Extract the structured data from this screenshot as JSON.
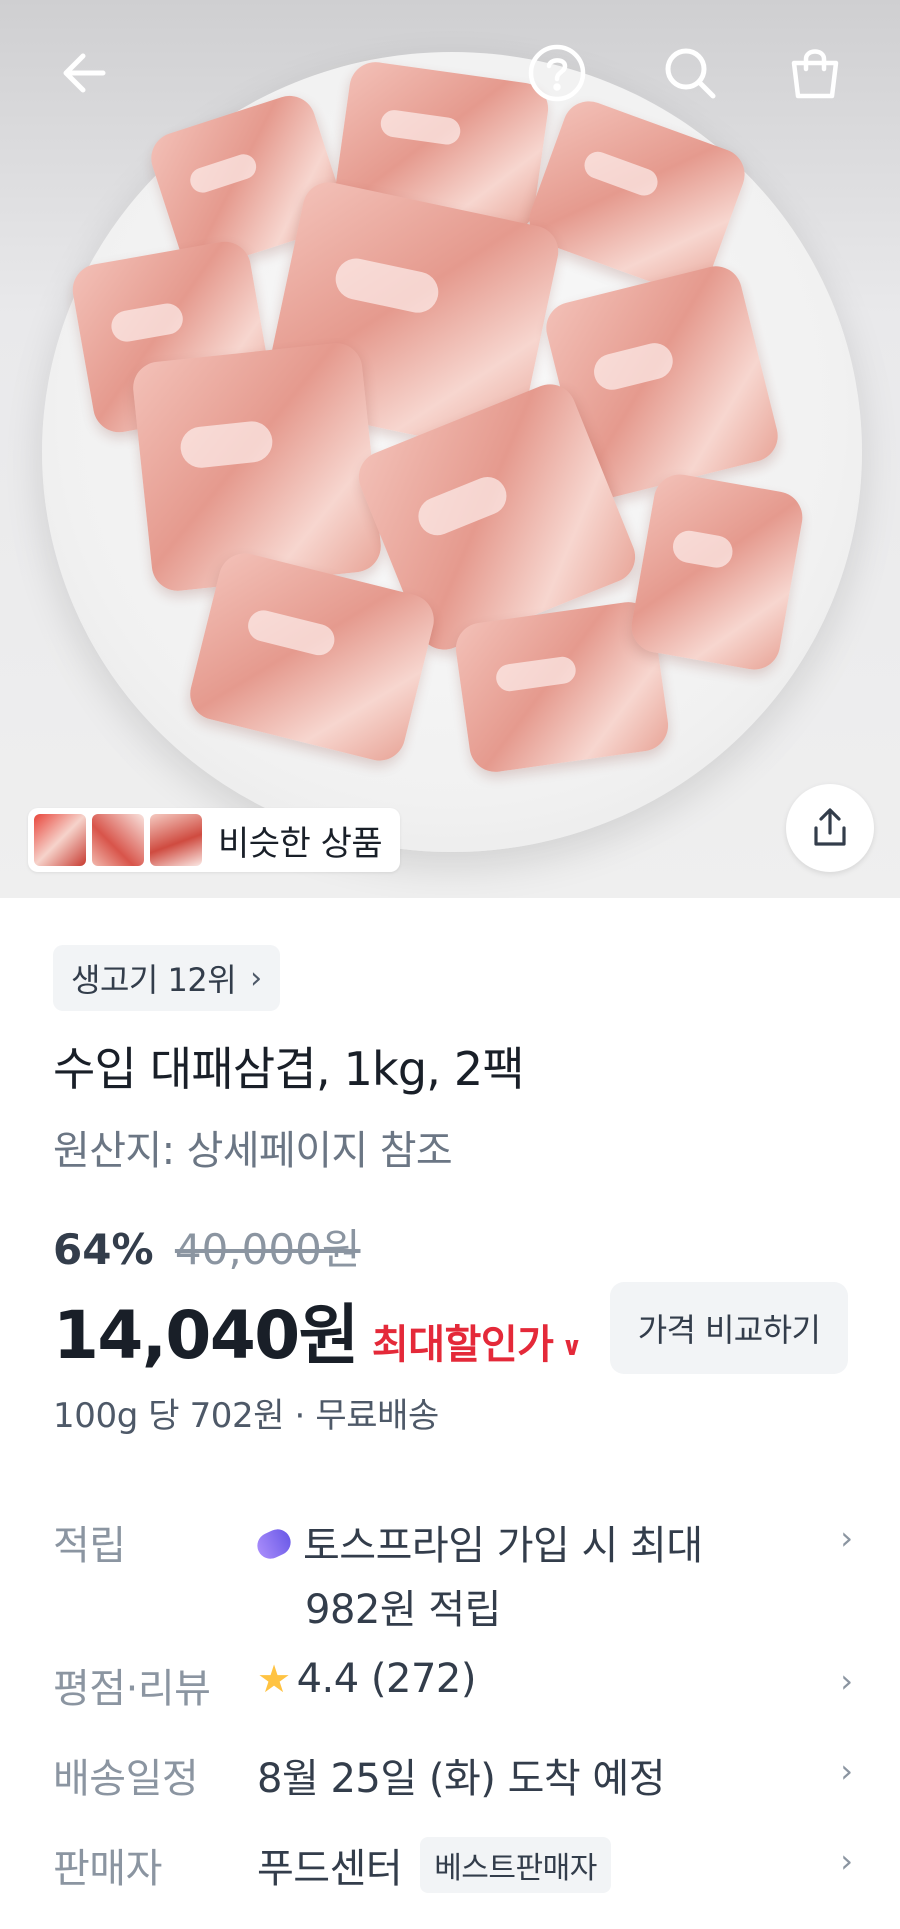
{
  "nav": {
    "back_icon": "back-arrow-icon",
    "help_icon": "question-circle-icon",
    "search_icon": "search-icon",
    "cart_icon": "shopping-bag-icon"
  },
  "gallery": {
    "similar_label": "비슷한 상품",
    "share_icon": "share-icon"
  },
  "product": {
    "rank_label": "생고기 12위",
    "title": "수입 대패삼겹, 1kg, 2팩",
    "origin": "원산지: 상세페이지 참조",
    "discount_rate": "64%",
    "original_price": "40,000원",
    "price": "14,040원",
    "max_discount_label": "최대할인가",
    "compare_button": "가격 비교하기",
    "unit_price": "100g 당 702원 · 무료배송"
  },
  "details": {
    "points_label": "적립",
    "points_line1": "토스프라임 가입 시 최대",
    "points_line2": "982원 적립",
    "rating_label": "평점·리뷰",
    "rating_value": "4.4",
    "review_count": "(272)",
    "delivery_label": "배송일정",
    "delivery_value": "8월 25일 (화) 도착 예정",
    "seller_label": "판매자",
    "seller_name": "푸드센터",
    "seller_badge": "베스트판매자"
  },
  "colors": {
    "accent_red": "#e42939",
    "star": "#ffc342",
    "text_primary": "#191f28",
    "text_muted": "#8b95a1"
  }
}
